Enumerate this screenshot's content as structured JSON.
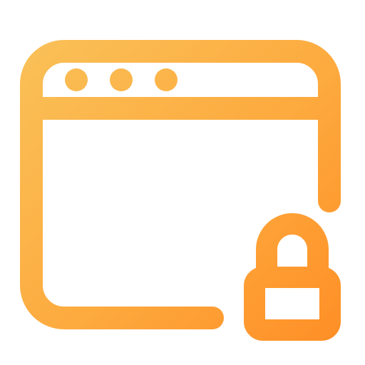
{
  "icon": {
    "name": "browser-window-lock-icon",
    "gradient": {
      "start": "#F9C55D",
      "mid": "#FDAA3E",
      "end": "#FE8A22"
    }
  }
}
